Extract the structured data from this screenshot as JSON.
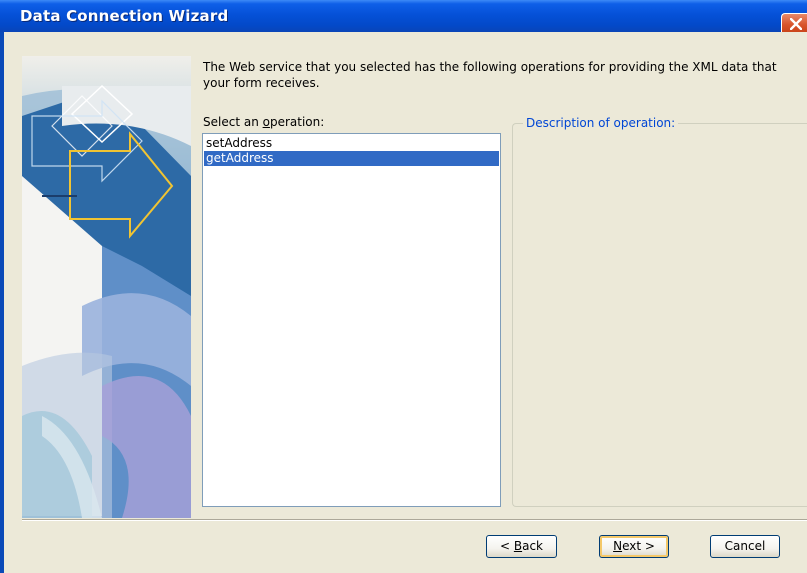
{
  "window": {
    "title": "Data Connection Wizard"
  },
  "content": {
    "intro_text": "The Web service that you selected has the following operations for providing the XML data that your form receives.",
    "operation_label": "Select an operation:",
    "operations": [
      {
        "label": "setAddress",
        "selected": false
      },
      {
        "label": "getAddress",
        "selected": true
      }
    ],
    "description_label": "Description of operation:",
    "description_text": ""
  },
  "buttons": {
    "back": "< Back",
    "next": "Next >",
    "cancel": "Cancel"
  },
  "colors": {
    "titlebar": "#0551d8",
    "selection": "#316ac5",
    "group_legend": "#0046d5",
    "dialog_bg": "#ece9d8"
  }
}
